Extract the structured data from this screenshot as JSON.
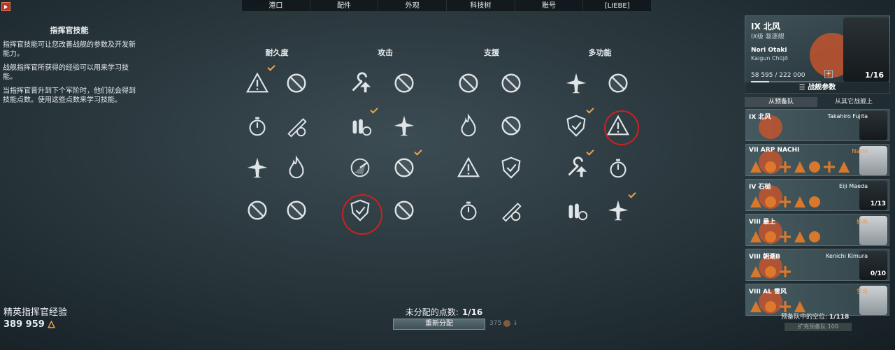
{
  "nav": {
    "items": [
      "港口",
      "配件",
      "外观",
      "科技树",
      "账号",
      "[LIEBE]"
    ]
  },
  "left": {
    "title": "指挥官技能",
    "paragraphs": [
      "指挥官技能可让您改善战舰的参数及开发新能力。",
      "战舰指挥官所获得的经验可以用来学习技能。",
      "当指挥官晋升到下个军阶时，他们就会得到技能点数。使用这些点数来学习技能。"
    ],
    "elite_label": "精英指挥官经验",
    "elite_value": "389 959"
  },
  "categories": [
    "耐久度",
    "攻击",
    "支援",
    "多功能"
  ],
  "skill_icons": [
    "warning-icon",
    "no-entry-icon",
    "wrench-icon",
    "stopwatch-icon",
    "torpedo-icon",
    "shell-icon",
    "plane-icon",
    "fire-icon",
    "radar-icon",
    "shield-icon"
  ],
  "bottom": {
    "unassigned_label": "未分配的点数:",
    "unassigned_value": "1/16",
    "redistribute": "重新分配",
    "cost": "375"
  },
  "commander": {
    "ship": "IX 北风",
    "ship_class": "IX级 驱逐舰",
    "name": "Nori Otaki",
    "rank": "Kaigun Chūjō",
    "xp": "58 595 / 222 000",
    "xp_fraction": 0.264,
    "points": "1/16",
    "params_label": "战舰参数"
  },
  "tabs": [
    "从预备队",
    "从其它战舰上"
  ],
  "crew": [
    {
      "ship": "IX 北风",
      "commander": "Takahiro Fujita",
      "count": "",
      "orange": false,
      "skills": 0
    },
    {
      "ship": "VII ARP NACHI",
      "commander": "Nachi",
      "count": "",
      "orange": true,
      "skills": 7
    },
    {
      "ship": "IV 石槌",
      "commander": "Eiji Maeda",
      "count": "1/13",
      "orange": false,
      "skills": 5
    },
    {
      "ship": "VIII 最上",
      "commander": "妙高",
      "count": "",
      "orange": true,
      "skills": 5
    },
    {
      "ship": "VIII 朝潮B",
      "commander": "Kenichi Kimura",
      "count": "0/10",
      "orange": false,
      "skills": 3
    },
    {
      "ship": "VIII AL 雪风",
      "commander": "雪风",
      "count": "",
      "orange": true,
      "skills": 4
    }
  ],
  "reserve": {
    "label": "预备队中的空位:",
    "value": "1/118",
    "expand": "扩充预备队 100"
  },
  "colors": {
    "accent": "#f1a24a",
    "highlight_ring": "#d1201c",
    "crew_skill": "#e07a2a"
  }
}
